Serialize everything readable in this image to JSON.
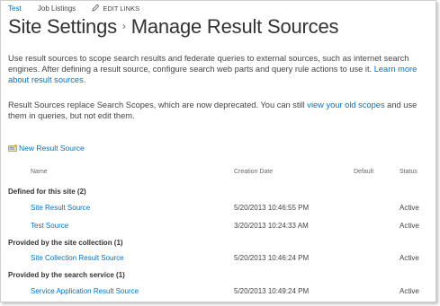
{
  "topnav": {
    "link1": "Test",
    "link2": "Job Listings",
    "edit": "EDIT LINKS"
  },
  "page": {
    "parent": "Site Settings",
    "title": "Manage Result Sources"
  },
  "description": {
    "text1": "Use result sources to scope search results and federate queries to external sources, such as internet search engines. After defining a result source, configure search web parts and query rule actions to use it. ",
    "link1": "Learn more about result sources.",
    "text2a": "Result Sources replace Search Scopes, which are now deprecated. You can still ",
    "link2": "view your old scopes",
    "text2b": " and use them in queries, but not edit them."
  },
  "toolbar": {
    "new_label": "New Result Source"
  },
  "table": {
    "headers": {
      "name": "Name",
      "date": "Creation Date",
      "default": "Default",
      "status": "Status"
    },
    "groups": [
      {
        "label": "Defined for this site (2)",
        "rows": [
          {
            "name": "Site Result Source",
            "date": "5/20/2013 10:46:55 PM",
            "status": "Active"
          },
          {
            "name": "Test Source",
            "date": "3/20/2013 10:24:33 AM",
            "status": "Active"
          }
        ]
      },
      {
        "label": "Provided by the site collection (1)",
        "rows": [
          {
            "name": "Site Collection Result Source",
            "date": "5/20/2013 10:46:24 PM",
            "status": "Active"
          }
        ]
      },
      {
        "label": "Provided by the search service (1)",
        "rows": [
          {
            "name": "Service Application Result Source",
            "date": "5/20/2013 10:49:24 PM",
            "status": "Active"
          }
        ]
      }
    ]
  }
}
